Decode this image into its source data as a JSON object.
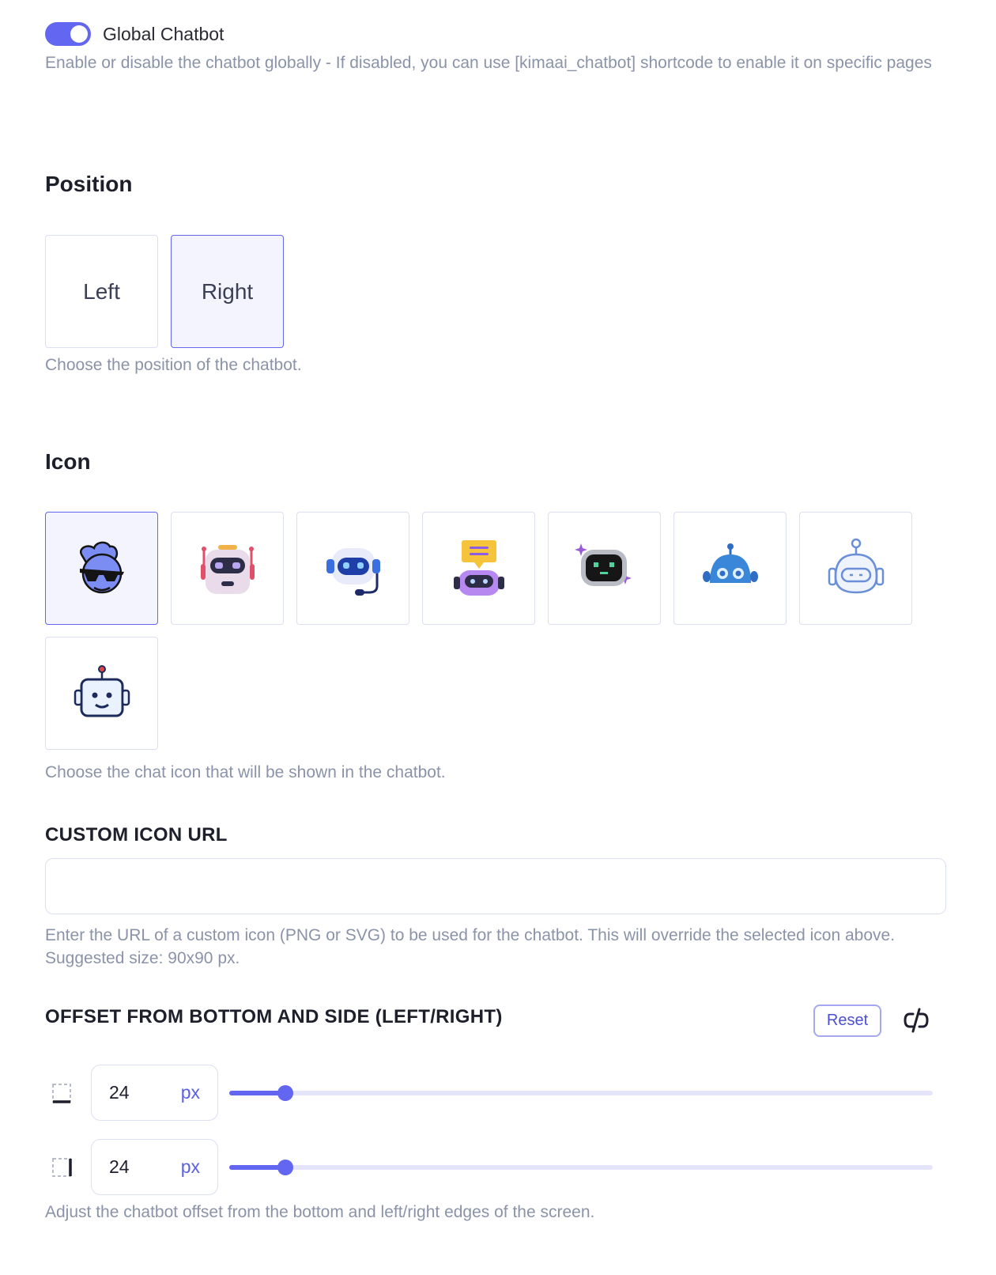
{
  "global_chatbot": {
    "label": "Global Chatbot",
    "enabled": true,
    "help": "Enable or disable the chatbot globally - If disabled, you can use [kimaai_chatbot] shortcode to enable it on specific pages"
  },
  "position": {
    "title": "Position",
    "options": [
      "Left",
      "Right"
    ],
    "selected": "Right",
    "help": "Choose the position of the chatbot."
  },
  "icon": {
    "title": "Icon",
    "options": [
      "robot-sunglasses-icon",
      "robot-pink-antenna-icon",
      "robot-headset-icon",
      "robot-chat-bubble-icon",
      "robot-sparkle-screen-icon",
      "robot-blue-dome-icon",
      "robot-outline-light-icon",
      "robot-outline-dark-icon"
    ],
    "selected_index": 0,
    "help": "Choose the chat icon that will be shown in the chatbot."
  },
  "custom_icon": {
    "title": "CUSTOM ICON URL",
    "value": "",
    "placeholder": "",
    "help": "Enter the URL of a custom icon (PNG or SVG) to be used for the chatbot. This will override the selected icon above. Suggested size: 90x90 px."
  },
  "offset": {
    "title": "OFFSET FROM BOTTOM AND SIDE (LEFT/RIGHT)",
    "reset_label": "Reset",
    "bottom": {
      "value": "24",
      "unit": "px",
      "fraction": 0.08
    },
    "side": {
      "value": "24",
      "unit": "px",
      "fraction": 0.08
    },
    "help": "Adjust the chatbot offset from the bottom and left/right edges of the screen."
  },
  "colors": {
    "accent": "#6366f1",
    "muted_text": "#8a93a8",
    "border": "#dcdff0"
  }
}
